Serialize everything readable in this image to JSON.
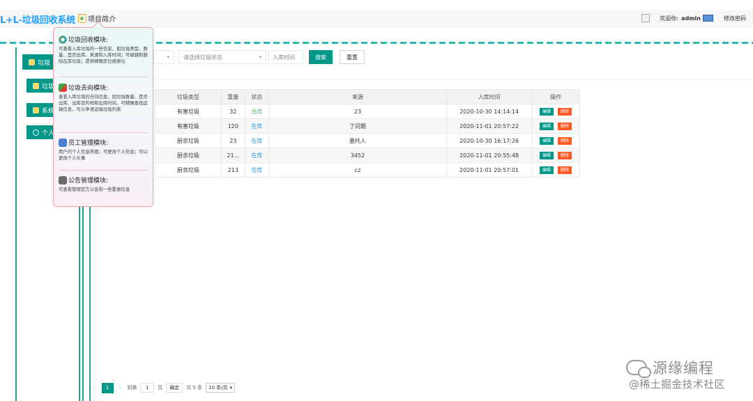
{
  "header": {
    "title": "L+L-垃圾回收系统",
    "intro_label": "项目简介",
    "welcome": "欢迎你:",
    "username": "admin",
    "change_password": "修改密码"
  },
  "sidebar": {
    "items": [
      {
        "label": "垃圾",
        "icon": "recycle-icon"
      },
      {
        "label": "垃圾",
        "icon": "flow-icon"
      },
      {
        "label": "系统",
        "icon": "system-icon"
      },
      {
        "label": "个人",
        "icon": "user-icon"
      }
    ]
  },
  "search": {
    "status_placeholder": "请选择垃圾状态",
    "date_placeholder": "入库时间",
    "search_label": "搜索",
    "reset_label": "重置"
  },
  "table": {
    "headers": {
      "type": "垃圾类型",
      "weight": "重量",
      "status": "状态",
      "source": "来源",
      "time": "入库时间",
      "ops": "操作"
    },
    "edit_label": "编辑",
    "delete_label": "删除",
    "rows": [
      {
        "type": "有害垃圾",
        "weight": "32",
        "status": "出库",
        "source": "23",
        "time": "2020-10-30 14:14:14"
      },
      {
        "type": "有害垃圾",
        "weight": "120",
        "status": "在库",
        "source": "了问题",
        "time": "2020-11-01 20:57:22"
      },
      {
        "type": "厨余垃圾",
        "weight": "23",
        "status": "在库",
        "source": "委托人",
        "time": "2020-10-30 16:17:26"
      },
      {
        "type": "厨余垃圾",
        "weight": "21...",
        "status": "在库",
        "source": "3452",
        "time": "2020-11-01 20:55:48"
      },
      {
        "type": "厨余垃圾",
        "weight": "213",
        "status": "在库",
        "source": "cz",
        "time": "2020-11-01 20:57:01"
      }
    ]
  },
  "pager": {
    "current": "1",
    "goto_label": "到第",
    "page_input": "1",
    "page_unit": "页",
    "confirm": "确定",
    "total": "共 5 条",
    "page_size": "10 条/页"
  },
  "popup": {
    "modules": [
      {
        "title": "垃圾回收模块:",
        "desc": "可查看入库垃圾的一些信息，如垃圾类型、数量、是否出库、来源和入库时间；可编辑和删除在库垃圾；提供精确定位搜索垃"
      },
      {
        "title": "垃圾去向模块:",
        "desc": "查看入库垃圾的去向信息，如垃圾数量、是否出库、出库目的地和出库时间，可精确查找运输信息，可以申请运输垃圾列表"
      },
      {
        "title": "员工管理模块:",
        "desc": "用户的个人信息界面；可更改个人信息；可以更改个人头像"
      },
      {
        "title": "公告管理模块:",
        "desc": "可查看管理官方公告和一些重要信息"
      }
    ]
  },
  "watermark": {
    "line1": "源缘编程",
    "line2": "@稀土掘金技术社区"
  },
  "colors": {
    "accent": "#009688",
    "brand": "#1e9fff",
    "danger": "#ff5722",
    "status_out": "#5fb878",
    "status_in": "#1e9fff"
  }
}
